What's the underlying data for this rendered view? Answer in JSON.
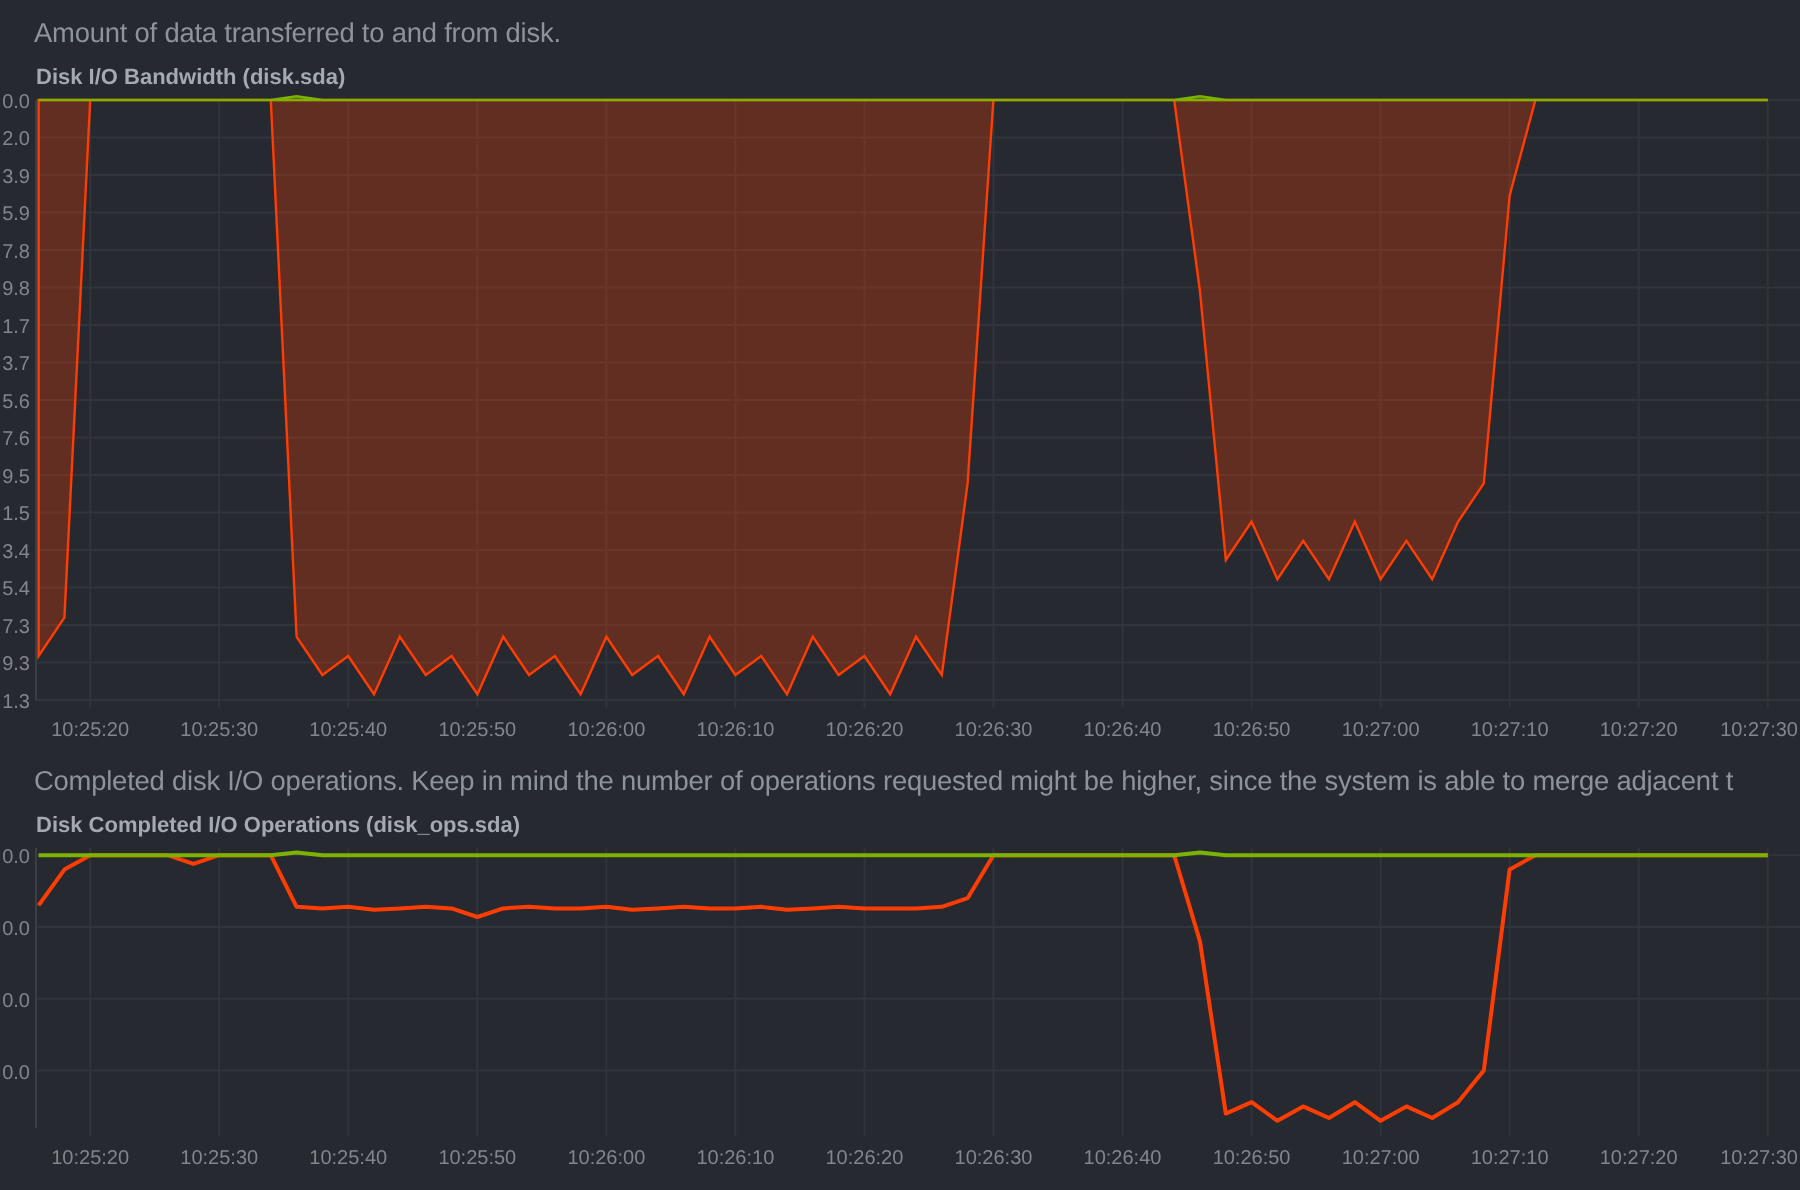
{
  "sections": [
    {
      "description": "Amount of data transferred to and from disk.",
      "title": "Disk I/O Bandwidth (disk.sda)",
      "kind": "area",
      "lines": [
        {
          "color": "#ff3d00"
        },
        {
          "color": "#7cb300"
        }
      ],
      "y_labels": [
        "0.0",
        "2.0",
        "3.9",
        "5.9",
        "7.8",
        "9.8",
        "1.7",
        "3.7",
        "5.6",
        "7.6",
        "9.5",
        "1.5",
        "3.4",
        "5.4",
        "7.3",
        "9.3",
        "1.3"
      ],
      "x_labels": [
        "10:25:20",
        "10:25:30",
        "10:25:40",
        "10:25:50",
        "10:26:00",
        "10:26:10",
        "10:26:20",
        "10:26:30",
        "10:26:40",
        "10:26:50",
        "10:27:00",
        "10:27:10",
        "10:27:20",
        "10:27:30"
      ]
    },
    {
      "description": "Completed disk I/O operations. Keep in mind the number of operations requested might be higher, since the system is able to merge adjacent t",
      "title": "Disk Completed I/O Operations (disk_ops.sda)",
      "kind": "line",
      "lines": [
        {
          "color": "#ff3d00"
        },
        {
          "color": "#7cb300"
        }
      ],
      "y_labels": [
        "0.0",
        "0.0",
        "0.0",
        "0.0"
      ],
      "x_labels": [
        "10:25:20",
        "10:25:30",
        "10:25:40",
        "10:25:50",
        "10:26:00",
        "10:26:10",
        "10:26:20",
        "10:26:30",
        "10:26:40",
        "10:26:50",
        "10:27:00",
        "10:27:10",
        "10:27:20",
        "10:27:30"
      ]
    }
  ]
}
